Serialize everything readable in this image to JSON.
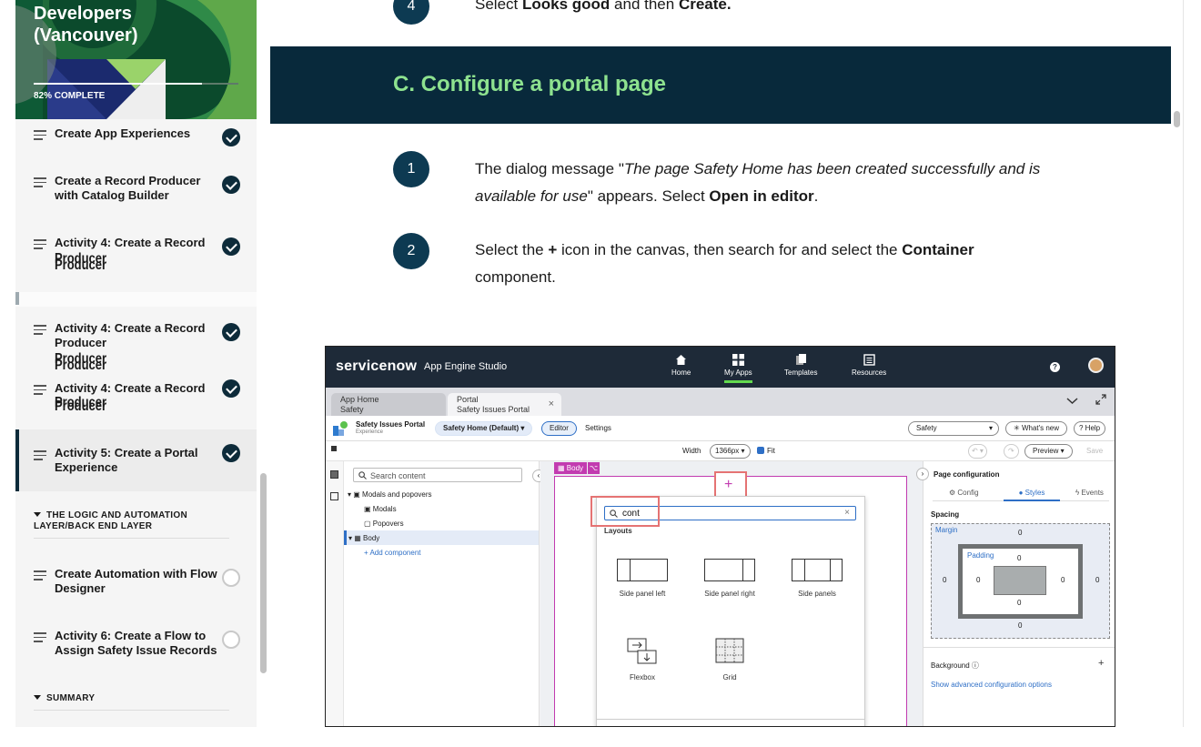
{
  "sidebar": {
    "course_title": "Developers\n(Vancouver)",
    "progress": {
      "label": "82% COMPLETE",
      "value": 0.82
    },
    "lessons": [
      {
        "label": "Create App Experiences",
        "status": "complete"
      },
      {
        "label": "Create a Record Producer with Catalog Builder",
        "status": "complete"
      },
      {
        "label": "Activity 4: Create a Record",
        "status": "complete",
        "ghost": "Producer"
      },
      {
        "label": "Activity 4: Create a Record Producer",
        "status": "complete",
        "ghost": "Producer"
      },
      {
        "label": "Activity 4: Create a Record",
        "status": "complete",
        "ghost": "Producer"
      },
      {
        "label": "Activity 5: Create a Portal Experience",
        "status": "complete"
      },
      {
        "label": "Create Automation with Flow Designer",
        "status": "incomplete"
      },
      {
        "label": "Activity 6: Create a Flow to Assign Safety Issue Records",
        "status": "incomplete"
      }
    ],
    "sections": [
      {
        "label": "THE LOGIC AND AUTOMATION LAYER/BACK END LAYER"
      },
      {
        "label": "SUMMARY"
      }
    ]
  },
  "main": {
    "prev_step": {
      "number": "4",
      "parts": [
        [
          "Select ",
          false
        ],
        [
          "Looks good",
          true
        ],
        [
          " and then ",
          false
        ],
        [
          "Create.",
          true
        ]
      ]
    },
    "section_title": "C. Configure a portal page",
    "steps": [
      {
        "number": "1",
        "parts": [
          [
            "The dialog message \"",
            false
          ],
          [
            "The page Safety Home has been created successfully and is available for use",
            "i"
          ],
          [
            "\" appears. Select ",
            false
          ],
          [
            "Open in editor",
            true
          ],
          [
            ".",
            false
          ]
        ]
      },
      {
        "number": "2",
        "parts": [
          [
            "Select the ",
            false
          ],
          [
            "+",
            true
          ],
          [
            " icon in the canvas, then search for and select the ",
            false
          ],
          [
            "Container",
            true
          ],
          [
            " component.",
            false
          ]
        ]
      }
    ]
  },
  "screenshot": {
    "brand": "servicenow",
    "app_name": "App Engine Studio",
    "nav": [
      {
        "label": "Home",
        "icon": "home-icon"
      },
      {
        "label": "My Apps",
        "icon": "grid-icon",
        "current": true
      },
      {
        "label": "Templates",
        "icon": "templates-icon"
      },
      {
        "label": "Resources",
        "icon": "resources-icon"
      }
    ],
    "tabs": [
      {
        "line1": "App Home",
        "line2": "Safety"
      },
      {
        "line1": "Portal",
        "line2": "Safety Issues Portal"
      }
    ],
    "portal": {
      "name": "Safety Issues Portal",
      "subtitle": "Experience",
      "page_select": "Safety Home (Default)",
      "editor": "Editor",
      "settings": "Settings",
      "app_select": "Safety",
      "whats_new": "What's new",
      "help": "Help"
    },
    "widthbar": {
      "width_label": "Width",
      "width_value": "1366px",
      "fit": "Fit",
      "preview": "Preview",
      "save": "Save"
    },
    "left_panel": {
      "search_placeholder": "Search content",
      "tree": [
        "Modals and popovers",
        "Modals",
        "Popovers",
        "Body",
        "+ Add component"
      ]
    },
    "canvas": {
      "body_tag": "Body",
      "search_value": "cont",
      "layouts_heading": "Layouts",
      "layouts": [
        "Side panel left",
        "Side panel right",
        "Side panels",
        "Flexbox",
        "Grid"
      ]
    },
    "right_panel": {
      "title": "Page configuration",
      "tabs": [
        "Config",
        "Styles",
        "Events"
      ],
      "spacing": "Spacing",
      "margin": "Margin",
      "padding": "Padding",
      "zero": "0",
      "background": "Background",
      "advanced": "Show advanced configuration options"
    }
  }
}
